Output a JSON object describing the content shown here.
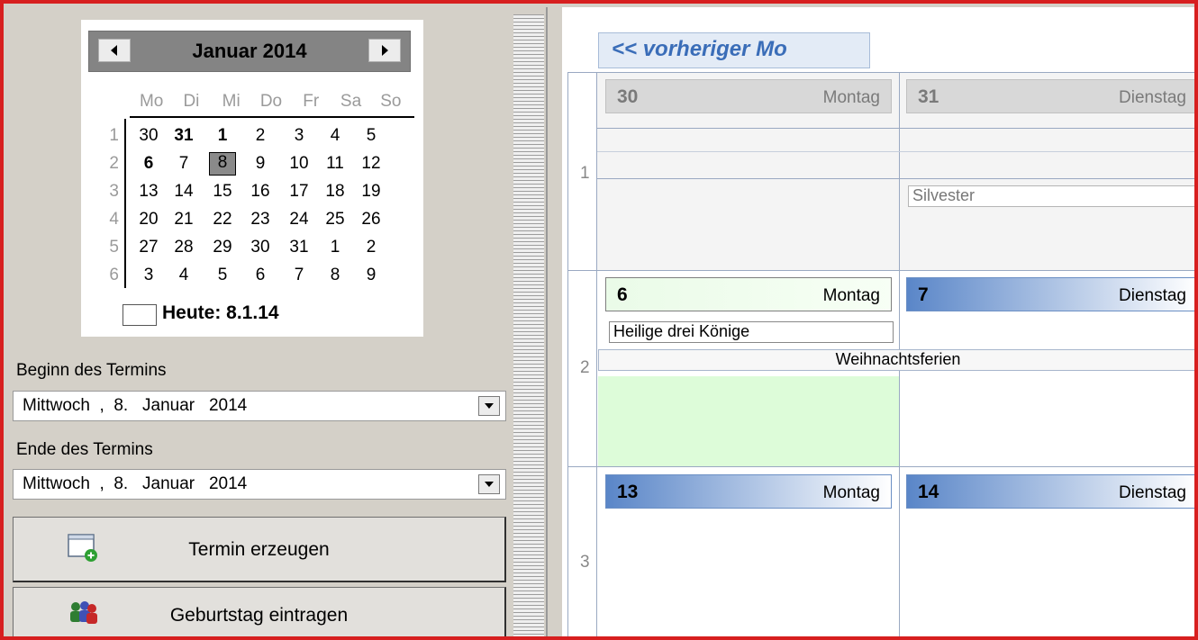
{
  "mini_calendar": {
    "title": "Januar 2014",
    "weekdays": [
      "Mo",
      "Di",
      "Mi",
      "Do",
      "Fr",
      "Sa",
      "So"
    ],
    "weeks": [
      {
        "num": "1",
        "days": [
          "30",
          "31",
          "1",
          "2",
          "3",
          "4",
          "5"
        ]
      },
      {
        "num": "2",
        "days": [
          "6",
          "7",
          "8",
          "9",
          "10",
          "11",
          "12"
        ]
      },
      {
        "num": "3",
        "days": [
          "13",
          "14",
          "15",
          "16",
          "17",
          "18",
          "19"
        ]
      },
      {
        "num": "4",
        "days": [
          "20",
          "21",
          "22",
          "23",
          "24",
          "25",
          "26"
        ]
      },
      {
        "num": "5",
        "days": [
          "27",
          "28",
          "29",
          "30",
          "31",
          "1",
          "2"
        ]
      },
      {
        "num": "6",
        "days": [
          "3",
          "4",
          "5",
          "6",
          "7",
          "8",
          "9"
        ]
      }
    ],
    "today_label": "Heute: 8.1.14",
    "selected_day": "8"
  },
  "form": {
    "start_label": "Beginn des Termins",
    "start_value": "Mittwoch  ,  8.   Januar   2014",
    "end_label": "Ende des Termins",
    "end_value": "Mittwoch  ,  8.   Januar   2014"
  },
  "buttons": {
    "create_label": "Termin erzeugen",
    "birthday_label": "Geburtstag eintragen"
  },
  "schedule": {
    "prev_label": "<< vorheriger Mo",
    "week1": {
      "num": "1",
      "mon_day": "30",
      "mon_name": "Montag",
      "tue_day": "31",
      "tue_name": "Dienstag",
      "tue_event": "Silvester"
    },
    "week2": {
      "num": "2",
      "mon_day": "6",
      "mon_name": "Montag",
      "tue_day": "7",
      "tue_name": "Dienstag",
      "mon_event": "Heilige drei Könige",
      "span_event": "Weihnachtsferien"
    },
    "week3": {
      "num": "3",
      "mon_day": "13",
      "mon_name": "Montag",
      "tue_day": "14",
      "tue_name": "Dienstag"
    }
  },
  "colors": {
    "frame": "#d71f1f",
    "accent": "#5a86c8",
    "today_green": "#eafbe8"
  }
}
